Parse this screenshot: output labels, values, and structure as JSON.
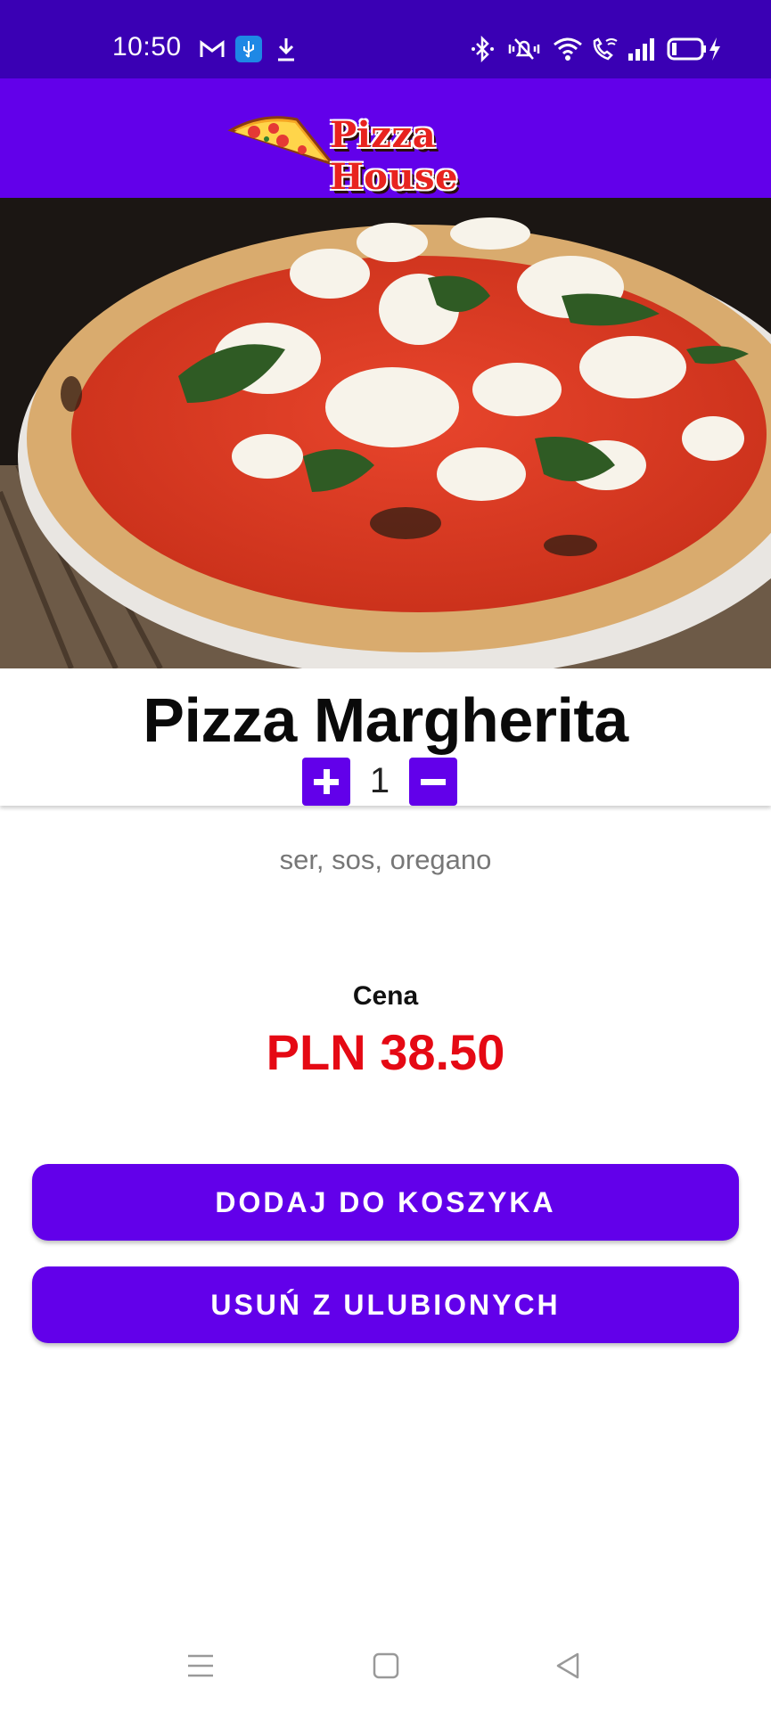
{
  "status_bar": {
    "time": "10:50",
    "left_icons": [
      "gmail-icon",
      "usb-icon",
      "download-icon"
    ],
    "right_icons": [
      "bluetooth-icon",
      "vibrate-mute-icon",
      "wifi-icon",
      "wifi-calling-icon",
      "signal-icon",
      "battery-charging-icon"
    ],
    "background": "#3a00b4"
  },
  "app_bar": {
    "logo_text": "Pizza House",
    "background": "#6200ea"
  },
  "product": {
    "name": "Pizza Margherita",
    "quantity": "1",
    "ingredients": "ser, sos, oregano",
    "price_label": "Cena",
    "price": "PLN 38.50"
  },
  "actions": {
    "add_to_cart": "DODAJ DO KOSZYKA",
    "remove_favorite": "USUŃ Z ULUBIONYCH"
  },
  "nav_bar": {
    "icons": [
      "menu-icon",
      "home-icon",
      "back-icon"
    ]
  },
  "colors": {
    "accent": "#6200ea",
    "price": "#e50914",
    "muted_text": "#777777"
  }
}
